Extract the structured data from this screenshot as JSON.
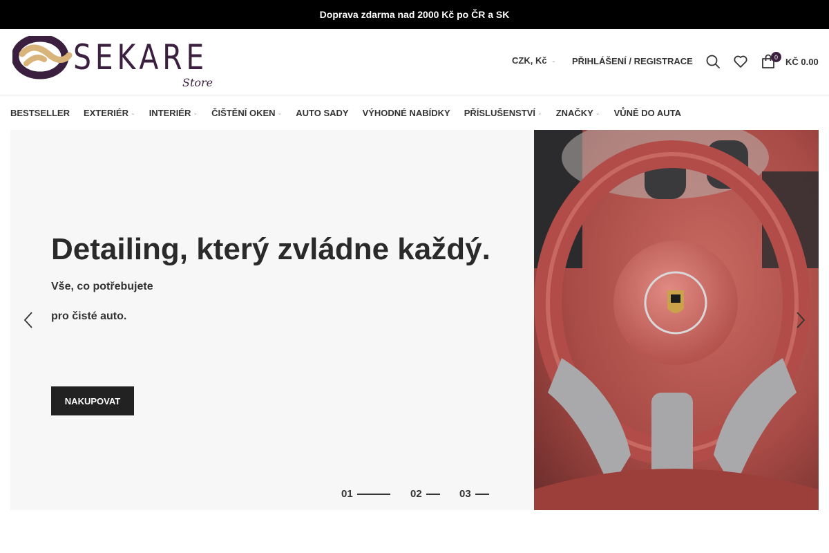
{
  "topbar": {
    "text": "Doprava zdarma nad 2000 Kč po ČR a SK"
  },
  "header": {
    "logo_word": "SEKARE",
    "logo_sub": "Store",
    "currency": "CZK, Kč",
    "login": "PŘIHLÁŠENÍ / REGISTRACE",
    "cart_count": "0",
    "cart_total": "KČ 0.00"
  },
  "nav": {
    "items": [
      {
        "label": "BESTSELLER"
      },
      {
        "label": "EXTERIÉR"
      },
      {
        "label": "INTERIÉR"
      },
      {
        "label": "ČIŠTĚNÍ OKEN"
      },
      {
        "label": "AUTO SADY"
      },
      {
        "label": "VÝHODNÉ NABÍDKY"
      },
      {
        "label": "PŘÍSLUŠENSTVÍ"
      },
      {
        "label": "ZNAČKY"
      },
      {
        "label": "VŮNĚ DO AUTA"
      }
    ]
  },
  "hero": {
    "title": "Detailing, který zvládne každý.",
    "sub1": "Vše, co potřebujete",
    "sub2": "pro čisté auto.",
    "cta": "NAKUPOVAT",
    "slides": [
      "01",
      "02",
      "03"
    ]
  },
  "colors": {
    "brand": "#3b1f3f",
    "accent": "#d8b37a",
    "dark": "#222222"
  }
}
